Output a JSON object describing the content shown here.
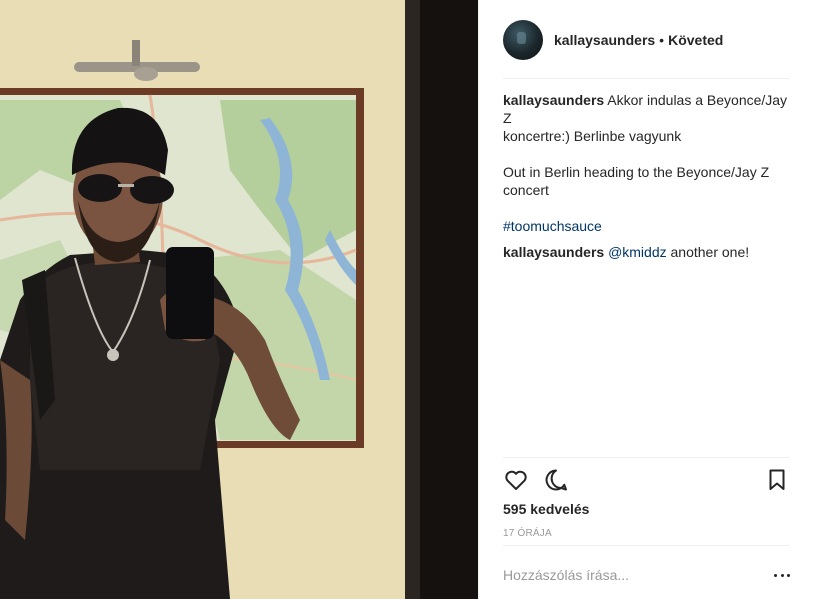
{
  "post": {
    "username": "kallaysaunders",
    "separator": "•",
    "follow_status": "Követed"
  },
  "comments": {
    "caption_user": "kallaysaunders",
    "caption_line1": "Akkor indulas a Beyonce/Jay Z",
    "caption_line2": "koncertre:) Berlinbe vagyunk",
    "caption_line3": "Out in Berlin heading to the Beyonce/Jay Z",
    "caption_line4": "concert",
    "hashtag": "#toomuchsauce",
    "reply_user": "kallaysaunders",
    "reply_mention": "@kmiddz",
    "reply_text": "another one!"
  },
  "actions": {
    "like_icon": "heart-icon",
    "comment_icon": "comment-icon",
    "save_icon": "bookmark-icon"
  },
  "stats": {
    "likes": "595 kedvelés",
    "time": "17 ÓRÁJA"
  },
  "composer": {
    "placeholder": "Hozzászólás írása..."
  },
  "colors": {
    "link": "#003569",
    "muted": "#999999",
    "divider": "#efefef",
    "text": "#262626"
  }
}
